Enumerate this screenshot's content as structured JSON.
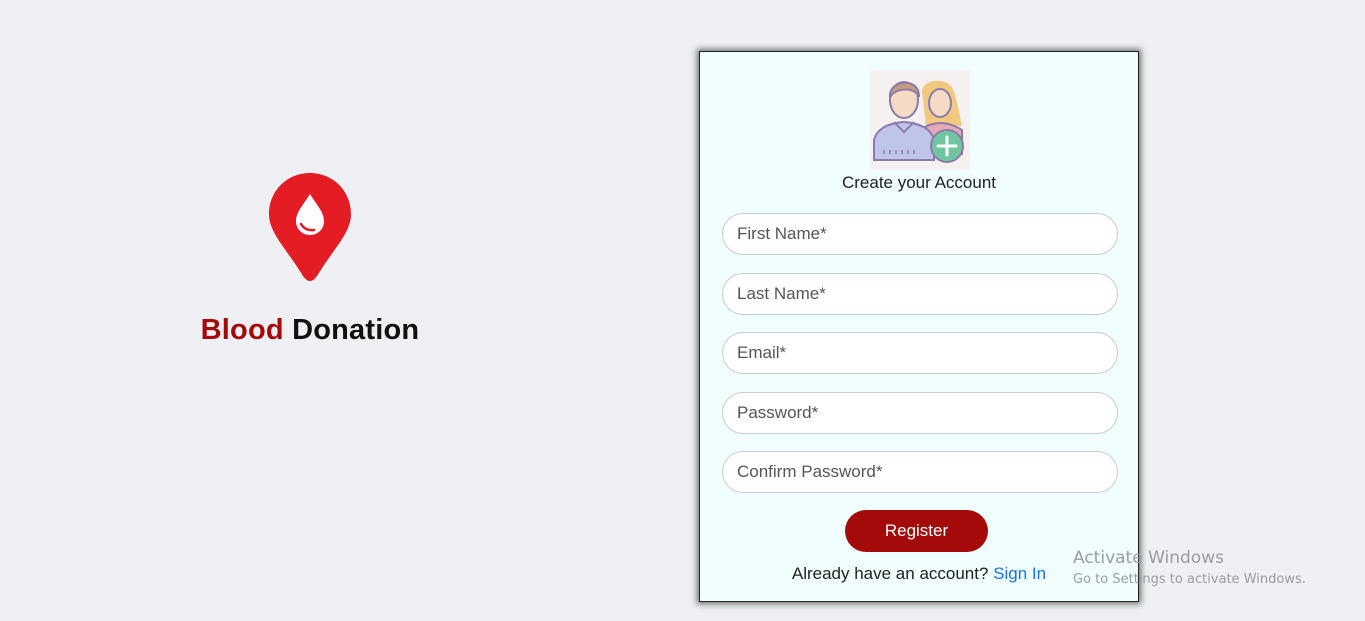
{
  "brand": {
    "title_accent": "Blood",
    "title_rest": "Donation",
    "logo_icon": "blood-drop-pin-icon",
    "accent_color": "#a50a0a",
    "pin_color": "#e41c23"
  },
  "register": {
    "avatar_icon": "add-user-icon",
    "title": "Create your Account",
    "fields": {
      "first_name": {
        "placeholder": "First Name*",
        "value": ""
      },
      "last_name": {
        "placeholder": "Last Name*",
        "value": ""
      },
      "email": {
        "placeholder": "Email*",
        "value": ""
      },
      "password": {
        "placeholder": "Password*",
        "value": ""
      },
      "confirm_password": {
        "placeholder": "Confirm Password*",
        "value": ""
      }
    },
    "submit_label": "Register",
    "signin_prompt": "Already have an account?",
    "signin_link": "Sign In",
    "card_bg": "#f0fefe",
    "link_color": "#1a73e8"
  },
  "watermark": {
    "title": "Activate Windows",
    "subtitle": "Go to Settings to activate Windows."
  }
}
